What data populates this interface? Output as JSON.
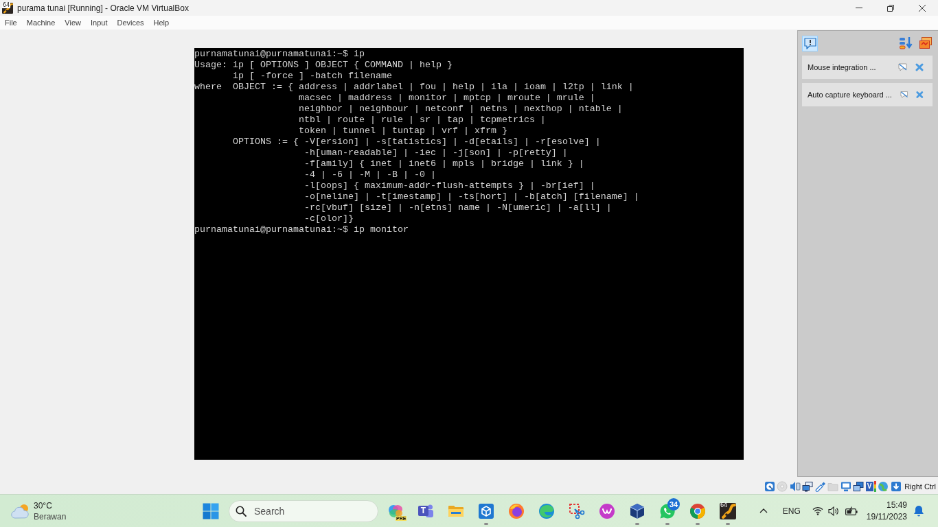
{
  "window": {
    "title": "purama tunai [Running] - Oracle VM VirtualBox",
    "icon_label": "64"
  },
  "menu": [
    "File",
    "Machine",
    "View",
    "Input",
    "Devices",
    "Help"
  ],
  "terminal": {
    "lines": [
      "purnamatunai@purnamatunai:~$ ip",
      "Usage: ip [ OPTIONS ] OBJECT { COMMAND | help }",
      "       ip [ -force ] -batch filename",
      "where  OBJECT := { address | addrlabel | fou | help | ila | ioam | l2tp | link |",
      "                   macsec | maddress | monitor | mptcp | mroute | mrule |",
      "                   neighbor | neighbour | netconf | netns | nexthop | ntable |",
      "                   ntbl | route | rule | sr | tap | tcpmetrics |",
      "                   token | tunnel | tuntap | vrf | xfrm }",
      "       OPTIONS := { -V[ersion] | -s[tatistics] | -d[etails] | -r[esolve] |",
      "                    -h[uman-readable] | -iec | -j[son] | -p[retty] |",
      "                    -f[amily] { inet | inet6 | mpls | bridge | link } |",
      "                    -4 | -6 | -M | -B | -0 |",
      "                    -l[oops] { maximum-addr-flush-attempts } | -br[ief] |",
      "                    -o[neline] | -t[imestamp] | -ts[hort] | -b[atch] [filename] |",
      "                    -rc[vbuf] [size] | -n[etns] name | -N[umeric] | -a[ll] |",
      "                    -c[olor]}",
      "purnamatunai@purnamatunai:~$ ip monitor"
    ]
  },
  "notification_center": {
    "toggle": {
      "selected": true
    },
    "notifications": [
      {
        "text": "Mouse integration ..."
      },
      {
        "text": "Auto capture keyboard ..."
      }
    ]
  },
  "status_bar": {
    "indicators": [
      {
        "kind": "harddisk",
        "active": true
      },
      {
        "kind": "optical",
        "active": false
      },
      {
        "kind": "audio",
        "active": true
      },
      {
        "kind": "network",
        "active": true
      },
      {
        "kind": "usb",
        "active": true
      },
      {
        "kind": "sharedfolder",
        "active": false
      },
      {
        "kind": "display",
        "active": true
      },
      {
        "kind": "recording",
        "active": true
      },
      {
        "kind": "features",
        "active": true,
        "label": "V"
      },
      {
        "kind": "mouse",
        "active": true
      },
      {
        "kind": "keyboard",
        "active": true
      }
    ],
    "host_key": "Right Ctrl"
  },
  "taskbar": {
    "weather": {
      "temperature": "30°C",
      "condition": "Berawan"
    },
    "search": {
      "placeholder": "Search"
    },
    "apps": [
      {
        "kind": "copilot",
        "running": false,
        "label": "PRE"
      },
      {
        "kind": "teams",
        "running": false,
        "label": "T"
      },
      {
        "kind": "explorer",
        "running": false
      },
      {
        "kind": "cube",
        "running": true
      },
      {
        "kind": "firefox",
        "running": false
      },
      {
        "kind": "edge",
        "running": false
      },
      {
        "kind": "snipping",
        "running": false
      },
      {
        "kind": "wps",
        "running": false
      },
      {
        "kind": "virtualbox",
        "running": true
      },
      {
        "kind": "whatsapp",
        "running": true,
        "badge": "34"
      },
      {
        "kind": "chrome",
        "running": true
      },
      {
        "kind": "vm",
        "running": true,
        "label": "64"
      }
    ],
    "tray": {
      "language": "ENG",
      "time": "15:49",
      "date": "19/11/2023"
    }
  }
}
